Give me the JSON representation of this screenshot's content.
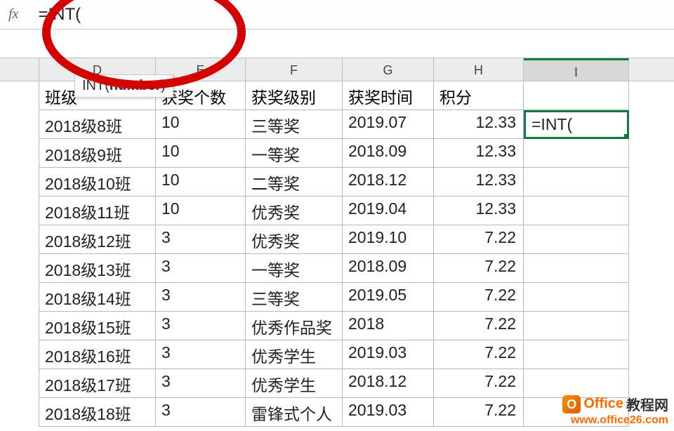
{
  "formula_bar": {
    "fx": "fx",
    "value": "=INT("
  },
  "tooltip": {
    "prefix": "INT(",
    "arg": "number",
    "suffix": ")"
  },
  "columns": {
    "D": "D",
    "E": "E",
    "F": "F",
    "G": "G",
    "H": "H",
    "I": "I"
  },
  "headers": {
    "D": "班级",
    "E": "获奖个数",
    "F": "获奖级别",
    "G": "获奖时间",
    "H": "积分",
    "I": ""
  },
  "active_cell_value": "=INT(",
  "rows": [
    {
      "D": "2018级8班",
      "E": "10",
      "F": "三等奖",
      "G": "2019.07",
      "H": "12.33",
      "I": "=INT(",
      "active": true
    },
    {
      "D": "2018级9班",
      "E": "10",
      "F": "一等奖",
      "G": "2018.09",
      "H": "12.33",
      "I": ""
    },
    {
      "D": "2018级10班",
      "E": "10",
      "F": "二等奖",
      "G": "2018.12",
      "H": "12.33",
      "I": ""
    },
    {
      "D": "2018级11班",
      "E": "10",
      "F": "优秀奖",
      "G": "2019.04",
      "H": "12.33",
      "I": ""
    },
    {
      "D": "2018级12班",
      "E": "3",
      "F": "优秀奖",
      "G": "2019.10",
      "H": "7.22",
      "I": ""
    },
    {
      "D": "2018级13班",
      "E": "3",
      "F": "一等奖",
      "G": "2018.09",
      "H": "7.22",
      "I": ""
    },
    {
      "D": "2018级14班",
      "E": "3",
      "F": "三等奖",
      "G": "2019.05",
      "H": "7.22",
      "I": ""
    },
    {
      "D": "2018级15班",
      "E": "3",
      "F": "优秀作品奖",
      "G": "2018",
      "H": "7.22",
      "I": ""
    },
    {
      "D": "2018级16班",
      "E": "3",
      "F": "优秀学生",
      "G": "2019.03",
      "H": "7.22",
      "I": ""
    },
    {
      "D": "2018级17班",
      "E": "3",
      "F": "优秀学生",
      "G": "2018.12",
      "H": "7.22",
      "I": ""
    },
    {
      "D": "2018级18班",
      "E": "3",
      "F": "雷锋式个人",
      "G": "2019.03",
      "H": "7.22",
      "I": ""
    }
  ],
  "watermark": {
    "brand": "Office",
    "brand_cn": "教程网",
    "url": "www.office26.com",
    "icon_letter": "O"
  }
}
